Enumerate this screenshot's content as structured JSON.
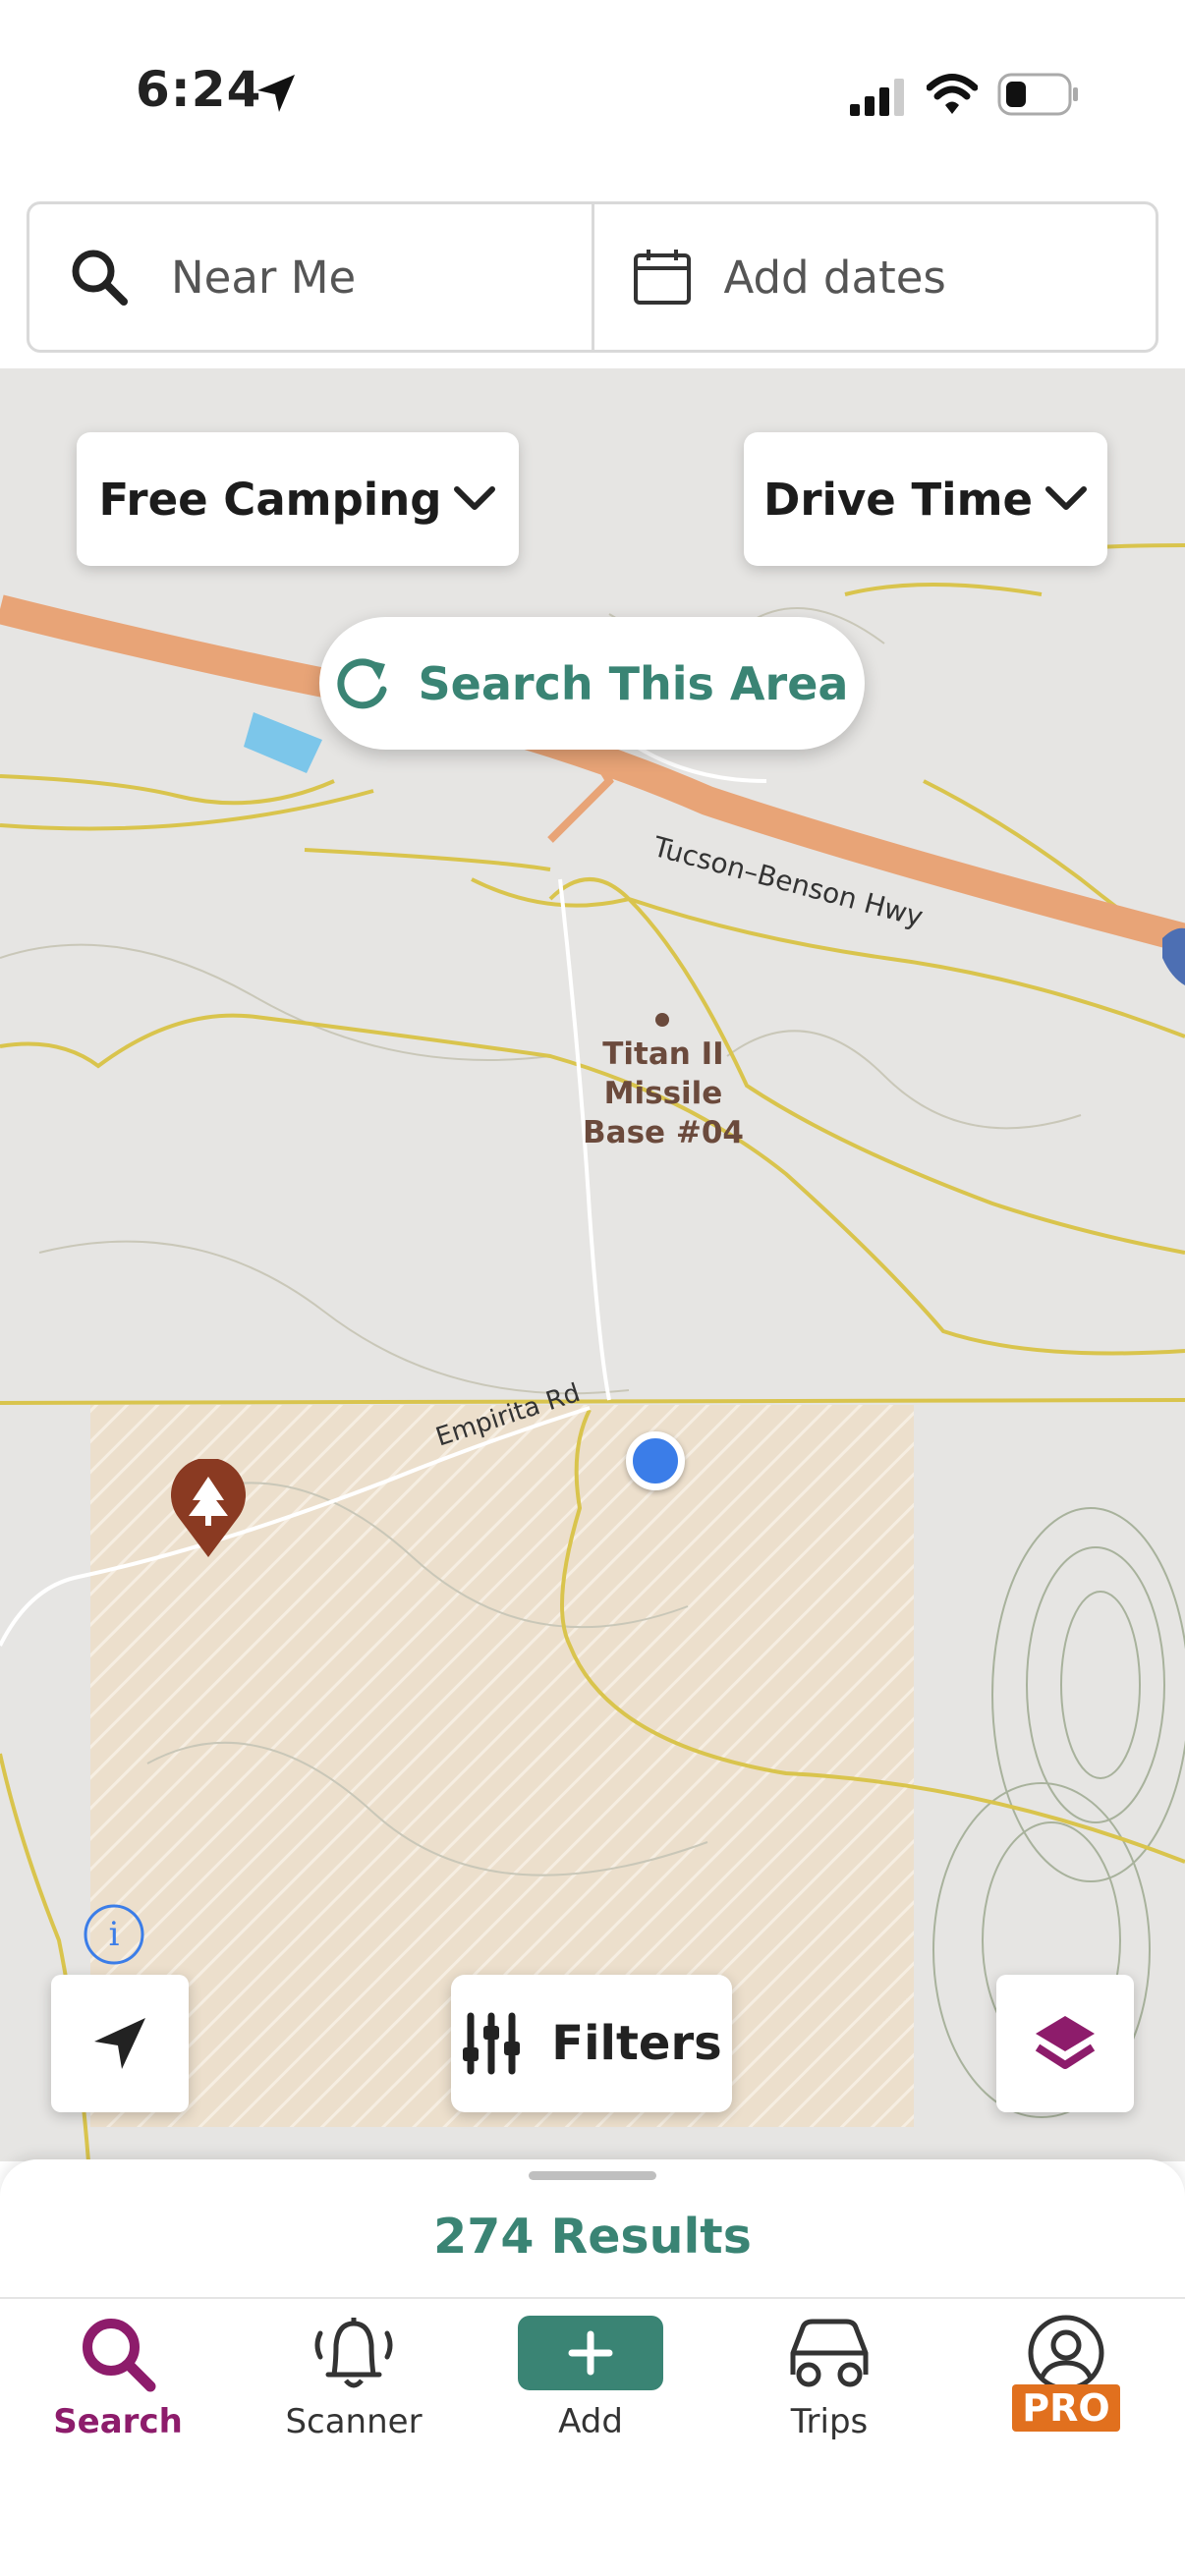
{
  "status_bar": {
    "time": "6:24"
  },
  "search": {
    "location_label": "Near Me",
    "dates_label": "Add dates"
  },
  "map_controls": {
    "category_dropdown": "Free Camping",
    "drive_time_dropdown": "Drive Time",
    "search_area_button": "Search This Area",
    "filters_button": "Filters"
  },
  "map_labels": {
    "highway": "Tucson–Benson Hwy",
    "poi": "Titan II Missile Base #04",
    "road": "Empirita Rd"
  },
  "results": {
    "count_label": "274 Results"
  },
  "tabs": [
    {
      "label": "Search",
      "icon": "search-icon",
      "active": true
    },
    {
      "label": "Scanner",
      "icon": "bell-icon",
      "active": false
    },
    {
      "label": "Add",
      "icon": "plus-icon",
      "active": false
    },
    {
      "label": "Trips",
      "icon": "car-icon",
      "active": false
    },
    {
      "label": "PRO",
      "icon": "profile-icon",
      "active": false
    }
  ],
  "colors": {
    "accent_green": "#3a8474",
    "active_tab": "#8d1c6b",
    "pro_badge": "#e1701e",
    "location_dot": "#3b7de8",
    "campsite_pin": "#8a3a22"
  }
}
